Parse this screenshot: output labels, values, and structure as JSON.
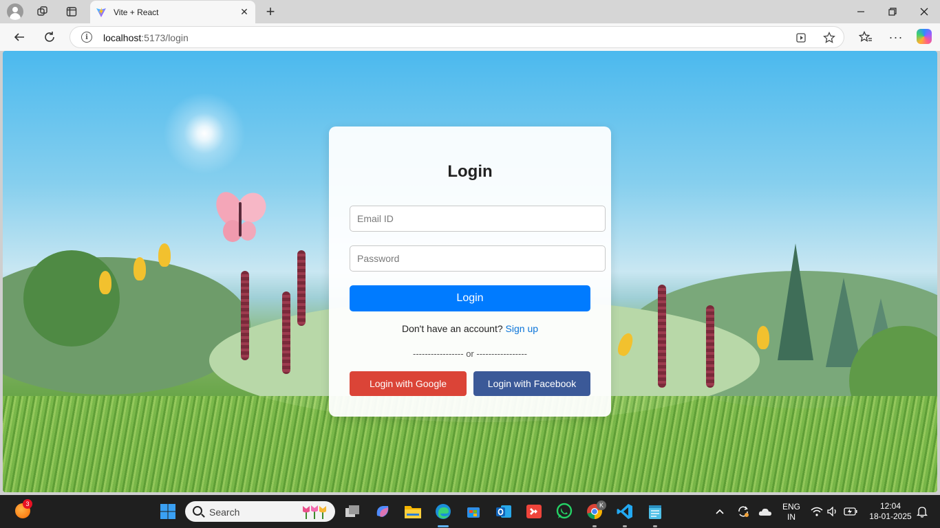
{
  "browser": {
    "tab_title": "Vite + React",
    "url_host": "localhost",
    "url_path": ":5173/login",
    "icons": [
      "profile-icon",
      "workspaces-icon",
      "tab-actions-icon",
      "vite-favicon",
      "close-icon",
      "new-tab-icon",
      "minimize-icon",
      "restore-icon",
      "window-close-icon",
      "back-icon",
      "reload-icon",
      "site-info-icon",
      "read-aloud-icon",
      "favorite-star-icon",
      "favorites-icon",
      "more-icon",
      "copilot-icon"
    ]
  },
  "login": {
    "title": "Login",
    "email_placeholder": "Email ID",
    "password_placeholder": "Password",
    "login_button": "Login",
    "signup_prompt": "Don't have an account?",
    "signup_link": "Sign up",
    "divider": "----------------- or -----------------",
    "google_button": "Login with Google",
    "facebook_button": "Login with Facebook",
    "colors": {
      "primary": "#007bff",
      "google": "#db4437",
      "facebook": "#3b5998",
      "link": "#0a74d9"
    }
  },
  "taskbar": {
    "weather_badge": "3",
    "search_placeholder": "Search",
    "language_line1": "ENG",
    "language_line2": "IN",
    "time": "12:04",
    "date": "18-01-2025",
    "chrome_badge": "K",
    "icons": [
      "weather-icon",
      "start-icon",
      "search-icon",
      "task-view-icon",
      "copilot-app-icon",
      "file-explorer-icon",
      "edge-icon",
      "store-icon",
      "outlook-icon",
      "anydesk-icon",
      "whatsapp-icon",
      "chrome-icon",
      "vscode-icon",
      "notepad-icon",
      "tray-chevron-icon",
      "sync-icon",
      "onedrive-icon",
      "wifi-icon",
      "volume-icon",
      "battery-icon",
      "notifications-icon"
    ]
  }
}
